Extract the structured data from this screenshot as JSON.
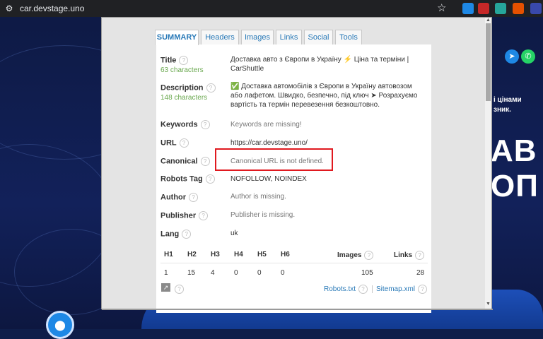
{
  "browser": {
    "url": "car.devstage.uno",
    "icons": [
      "tune-icon",
      "star-icon",
      "extension-icon",
      "extension-icon",
      "extension-icon",
      "extension-icon",
      "extension-icon"
    ]
  },
  "tabs": [
    "SUMMARY",
    "Headers",
    "Images",
    "Links",
    "Social",
    "Tools"
  ],
  "summary": {
    "title_label": "Title",
    "title_count": "63 characters",
    "title_value": "Доставка авто з Європи в Україну ⚡ Ціна та терміни | CarShuttle",
    "description_label": "Description",
    "description_count": "148 characters",
    "description_value": "✅ Доставка автомобілів з Європи в Україну автовозом або лафетом. Швидко, безпечно, під ключ ➤ Розрахуємо вартість та термін перевезення безкоштовно.",
    "keywords_label": "Keywords",
    "keywords_value": "Keywords are missing!",
    "url_label": "URL",
    "url_value": "https://car.devstage.uno/",
    "canonical_label": "Canonical",
    "canonical_value": "Canonical URL is not defined.",
    "robots_label": "Robots Tag",
    "robots_value": "NOFOLLOW, NOINDEX",
    "author_label": "Author",
    "author_value": "Author is missing.",
    "publisher_label": "Publisher",
    "publisher_value": "Publisher is missing.",
    "lang_label": "Lang",
    "lang_value": "uk"
  },
  "stats": {
    "headers": [
      "H1",
      "H2",
      "H3",
      "H4",
      "H5",
      "H6",
      "Images",
      "Links"
    ],
    "values": [
      "1",
      "15",
      "4",
      "0",
      "0",
      "0",
      "105",
      "28"
    ]
  },
  "footer_links": {
    "robots": "Robots.txt",
    "sitemap": "Sitemap.xml"
  },
  "background_site": {
    "side_line1": "і цінами",
    "side_line2": "зник.",
    "big_line1": "АВ",
    "big_line2": "ОП"
  },
  "colors": {
    "accent": "#2a7ab8",
    "count_green": "#6aa84f",
    "highlight_red": "#e0191f"
  }
}
